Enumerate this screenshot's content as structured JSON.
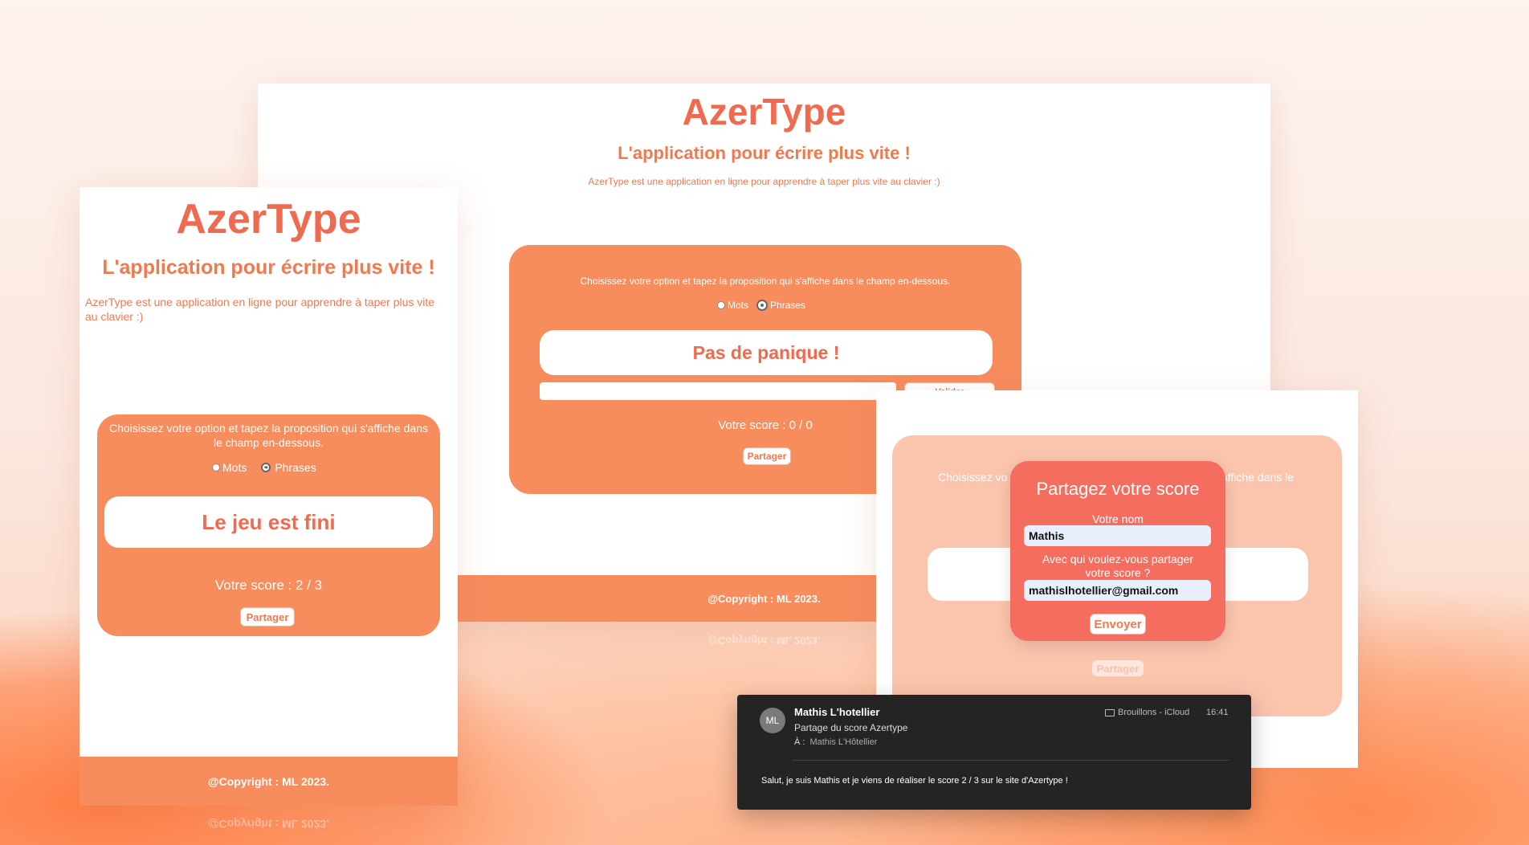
{
  "brand": {
    "accent": "#ef6a4e",
    "card": "#f78c5d",
    "modal": "#f46d5f"
  },
  "desktop": {
    "title": "AzerType",
    "subtitle": "L'application pour écrire plus vite !",
    "description": "AzerType est une application en ligne pour apprendre à taper plus vite au clavier :)",
    "instructions": "Choisissez votre option et tapez la proposition qui s'affiche dans le champ en-dessous.",
    "option_words": "Mots",
    "option_sentences": "Phrases",
    "prompt": "Pas de panique !",
    "input_value": "",
    "validate_label": "Valider",
    "score": "Votre score : 0 / 0",
    "share_label": "Partager",
    "footer": "@Copyright : ML 2023.",
    "footer_reflection": "@Copyright : ML 2023."
  },
  "mobile": {
    "title": "AzerType",
    "subtitle": "L'application pour écrire plus vite !",
    "description": "AzerType est une application en ligne pour apprendre à taper plus vite au clavier :)",
    "instructions": "Choisissez votre option et tapez la proposition qui s'affiche dans le champ en-dessous.",
    "option_words": "Mots",
    "option_sentences": "Phrases",
    "prompt": "Le jeu est fini",
    "score": "Votre score : 2 / 3",
    "share_label": "Partager",
    "footer": "@Copyright : ML 2023.",
    "footer_reflection": "@Copyright : ML 2023."
  },
  "share": {
    "bg_left": "Choisissez vo",
    "bg_right": "affiche dans le",
    "modal_title": "Partagez votre score",
    "name_label": "Votre nom",
    "name_value": "Mathis",
    "email_label_1": "Avec qui voulez-vous partager",
    "email_label_2": "votre score ?",
    "email_value": "mathislhotellier@gmail.com",
    "send_label": "Envoyer",
    "share_label": "Partager"
  },
  "email": {
    "avatar": "ML",
    "sender": "Mathis L'hotellier",
    "subject": "Partage du score Azertype",
    "to_label": "À :",
    "to": "Mathis L'Hôtellier",
    "folder": "Brouillons - iCloud",
    "time": "16:41",
    "body": "Salut, je suis Mathis et je viens de réaliser le score 2 / 3 sur le site d'Azertype !"
  }
}
